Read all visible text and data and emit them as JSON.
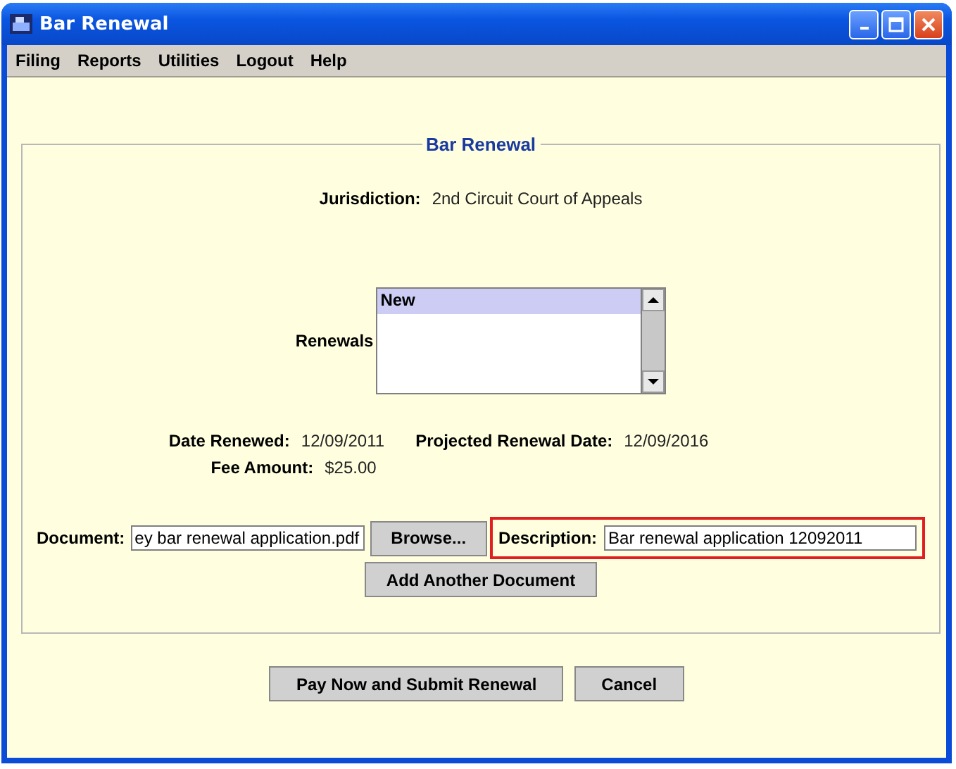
{
  "window": {
    "title": "Bar Renewal"
  },
  "menu": [
    {
      "label": "Filing"
    },
    {
      "label": "Reports"
    },
    {
      "label": "Utilities"
    },
    {
      "label": "Logout"
    },
    {
      "label": "Help"
    }
  ],
  "panel": {
    "title": "Bar Renewal"
  },
  "jurisdiction": {
    "label": "Jurisdiction:",
    "value": "2nd Circuit Court of Appeals"
  },
  "renewals": {
    "label": "Renewals",
    "items": [
      {
        "label": "New",
        "selected": true
      }
    ]
  },
  "date_renewed": {
    "label": "Date Renewed:",
    "value": "12/09/2011"
  },
  "projected_date": {
    "label": "Projected Renewal Date:",
    "value": "12/09/2016"
  },
  "fee": {
    "label": "Fee Amount:",
    "value": "$25.00"
  },
  "document": {
    "label": "Document:",
    "value": "ey bar renewal application.pdf"
  },
  "browse_button": "Browse...",
  "description": {
    "label": "Description:",
    "value": "Bar renewal application 12092011",
    "highlighted": true
  },
  "add_button": "Add Another Document",
  "buttons": [
    "Pay Now and Submit Renewal",
    "Cancel"
  ]
}
